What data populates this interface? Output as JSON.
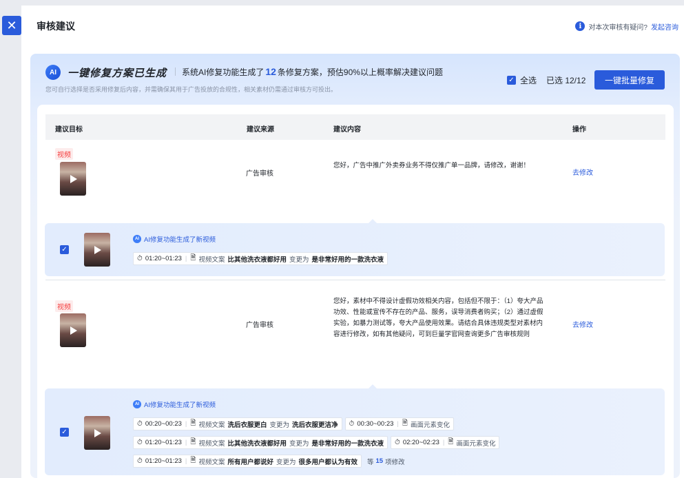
{
  "close_icon": "close-icon",
  "header": {
    "title": "审核建议",
    "question": "对本次审核有疑问?",
    "consult_link": "发起咨询"
  },
  "ai_banner": {
    "logo": "AI",
    "heading": "一键修复方案已生成",
    "summary_prefix": "系统AI修复功能生成了",
    "count": "12",
    "summary_suffix": "条修复方案，预估90%以上概率解决建议问题",
    "subtext": "您可自行选择是否采用修复后内容，并需确保其用于广告投放的合规性，相关素材仍需通过审核方可投出。",
    "select_all": "全选",
    "selected": "已选 12/12",
    "batch_button": "一键批量修复"
  },
  "table": {
    "columns": [
      "建议目标",
      "建议来源",
      "建议内容",
      "操作"
    ]
  },
  "rows": [
    {
      "tag": "视频",
      "source": "广告审核",
      "content": "您好，广告中推广外卖券业务不得仅推广单一品牌，请修改，谢谢！",
      "action": "去修改",
      "suggestion": {
        "ai_label_bold": "AI修复功能",
        "ai_label_rest": "生成了新视频",
        "chip_rows": [
          [
            {
              "time": "01:20~01:23",
              "kind": "视频文案",
              "from": "比其他洗衣液都好用",
              "verb": "变更为",
              "to": "是非常好用的一款洗衣液"
            }
          ]
        ]
      }
    },
    {
      "tag": "视频",
      "source": "广告审核",
      "content": "您好，素材中不得设计虚假功效相关内容，包括但不限于：（1）夸大产品功效、性能或宣传不存在的产品、服务，误导消费者购买；（2）通过虚假实验，如暴力测试等，夸大产品使用效果。请结合具体违规类型对素材内容进行修改，如有其他疑问，可到巨量学官网查询更多广告审核规则",
      "action": "去修改",
      "suggestion": {
        "ai_label_bold": "AI修复功能",
        "ai_label_rest": "生成了新视频",
        "chip_rows": [
          [
            {
              "time": "00:20~00:23",
              "kind": "视频文案",
              "from": "洗后衣服更白",
              "verb": "变更为",
              "to": "洗后衣服更洁净"
            },
            {
              "time": "00:30~00:23",
              "kind": "画面元素变化"
            }
          ],
          [
            {
              "time": "01:20~01:23",
              "kind": "视频文案",
              "from": "比其他洗衣液都好用",
              "verb": "变更为",
              "to": "是非常好用的一款洗衣液"
            },
            {
              "time": "02:20~02:23",
              "kind": "画面元素变化"
            }
          ],
          [
            {
              "time": "01:20~01:23",
              "kind": "视频文案",
              "from": "所有用户都说好",
              "verb": "变更为",
              "to": "很多用户都认为有效"
            }
          ]
        ],
        "extra_prefix": "等",
        "extra_count": "15",
        "extra_suffix": "项修改"
      }
    }
  ]
}
